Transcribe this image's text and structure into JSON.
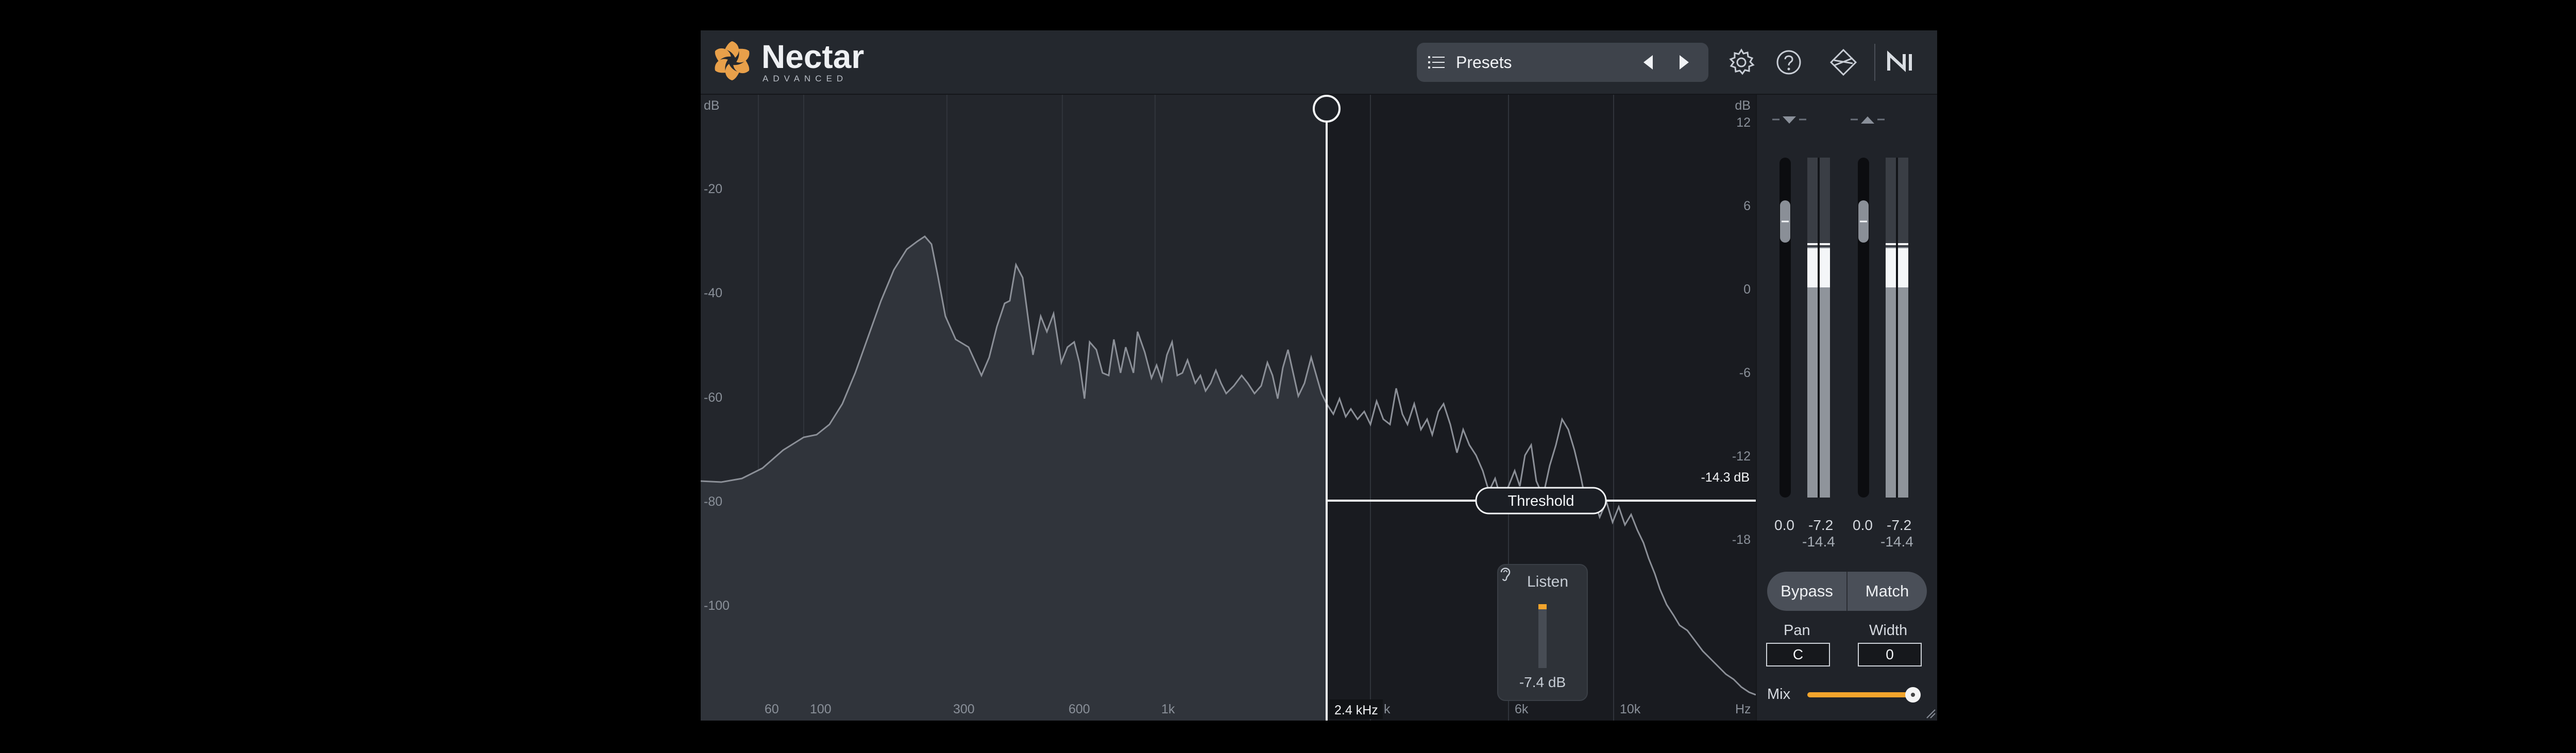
{
  "app": {
    "name": "Nectar",
    "subtitle": "ADVANCED"
  },
  "header": {
    "presets_label": "Presets",
    "icons": [
      "list-icon",
      "prev-arrow-icon",
      "next-arrow-icon",
      "gear-icon",
      "help-icon",
      "route-icon",
      "ni-logo-icon"
    ]
  },
  "graph": {
    "left_axis_unit": "dB",
    "left_axis": [
      "-20",
      "-40",
      "-60",
      "-80",
      "-100"
    ],
    "right_axis_unit": "dB",
    "right_axis": [
      "12",
      "6",
      "0",
      "-6",
      "-12",
      "-18"
    ],
    "freq_labels": [
      "60",
      "100",
      "300",
      "600",
      "1k",
      "k",
      "6k",
      "10k",
      "Hz"
    ],
    "cursor_freq": "2.4 kHz",
    "threshold_label": "Threshold",
    "threshold_value": "-14.3 dB"
  },
  "listen": {
    "label": "Listen",
    "value": "-7.4 dB"
  },
  "meters": {
    "input": {
      "gain": "0.0",
      "peak": "-7.2",
      "rms": "-14.4"
    },
    "output": {
      "gain": "0.0",
      "peak": "-7.2",
      "rms": "-14.4"
    }
  },
  "panel": {
    "bypass": "Bypass",
    "match": "Match",
    "pan_label": "Pan",
    "pan_value": "C",
    "width_label": "Width",
    "width_value": "0",
    "mix_label": "Mix",
    "mix_level": 1.0
  },
  "colors": {
    "accent": "#f2a42c",
    "background": "#1b1e24",
    "curve": "#8c9098"
  }
}
